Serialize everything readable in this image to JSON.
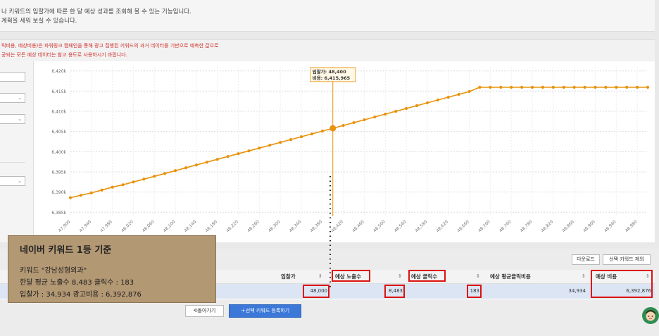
{
  "header": {
    "description_line1": "나 키워드의 입찰가에 따른 한 달 예상 성과를 조회해 볼 수 있는 기능입니다.",
    "description_line2": "계획을 세워 보실 수 있습니다."
  },
  "notice": {
    "line1": "릭비용, 예상비용)은 파워링크 캠페인을 통해 광고 집행된 키워드의 과거 데이터를 기반으로 예측한 값으로",
    "line2": "공되는 모든 예상 데이터는 참고 용도로 사용하시기 바랍니다."
  },
  "controls": {
    "dropdown_icon": "chevron-down-icon"
  },
  "chart_data": {
    "type": "line",
    "x": [
      47900,
      47920,
      47940,
      47960,
      47980,
      48000,
      48020,
      48040,
      48060,
      48080,
      48100,
      48120,
      48140,
      48160,
      48180,
      48200,
      48220,
      48240,
      48260,
      48280,
      48300,
      48320,
      48340,
      48360,
      48380,
      48400,
      48420,
      48440,
      48460,
      48480,
      48500,
      48520,
      48540,
      48560,
      48580,
      48600,
      48620,
      48640,
      48660,
      48680,
      48700,
      48720,
      48740,
      48760,
      48780,
      48800,
      48820,
      48840,
      48860,
      48880,
      48900,
      48920,
      48940,
      48960,
      48980,
      49000
    ],
    "y_labels": [
      "6,420k",
      "6,415k",
      "6,410k",
      "6,405k",
      "6,400k",
      "6,395k",
      "6,390k",
      "6,385k"
    ],
    "series": [
      {
        "values": [
          6388600,
          6389200,
          6389800,
          6390500,
          6391200,
          6391800,
          6392500,
          6393200,
          6393900,
          6394600,
          6395300,
          6396000,
          6396700,
          6397400,
          6398100,
          6398800,
          6399500,
          6400200,
          6400900,
          6401600,
          6402300,
          6403000,
          6403700,
          6404400,
          6405100,
          6405800,
          6406500,
          6407200,
          6407900,
          6408600,
          6409300,
          6410000,
          6410700,
          6411400,
          6412100,
          6412800,
          6413500,
          6414200,
          6414900,
          6415965,
          6415965,
          6415965,
          6415965,
          6415965,
          6415965,
          6415965,
          6415965,
          6415965,
          6415965,
          6415965,
          6415965,
          6415965,
          6415965,
          6415965,
          6415965,
          6415965
        ]
      }
    ],
    "ylim": [
      6384000,
      6421000
    ],
    "grid": true,
    "color": "#e8930c",
    "tooltip": {
      "line1": "입찰가: 48,400",
      "line2": "비용: 6,415,965"
    },
    "highlight_x": 48400
  },
  "toolbar": {
    "download_label": "다운로드",
    "exclude_label": "선택 키워드 제외"
  },
  "table": {
    "headers": {
      "bid": "입찰가",
      "impressions": "예상 노출수",
      "clicks": "예상 클릭수",
      "cpc": "예상 평균클릭비용",
      "cost": "예상 비용"
    },
    "sort_glyph": "⇕",
    "row": {
      "bid": "48,000",
      "impressions": "8,483",
      "clicks": "183",
      "cpc": "34,934",
      "cost": "6,392,876"
    }
  },
  "actions": {
    "back_label": "돌아가기",
    "register_label": "선택 키워드 등록하기"
  },
  "callout": {
    "title": "네이버 키워드 1등 기준",
    "line1": "키워드 \"강남성형외과\"",
    "line2": "한달 평균 노출수 8,483 클릭수 : 183",
    "line3": "입찰가 : 34,934 광고비용 : 6,392,876"
  },
  "colors": {
    "accent": "#e8930c",
    "highlight_border": "#dd1111",
    "button_blue": "#3b78d8"
  }
}
